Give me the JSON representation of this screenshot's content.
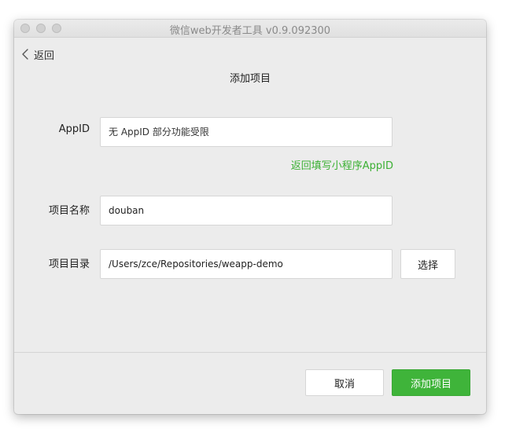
{
  "window": {
    "title": "微信web开发者工具 v0.9.092300"
  },
  "nav": {
    "back_label": "返回"
  },
  "page": {
    "title": "添加项目"
  },
  "form": {
    "appid": {
      "label": "AppID",
      "placeholder": "无 AppID 部分功能受限",
      "value": ""
    },
    "appid_link": "返回填写小程序AppID",
    "project_name": {
      "label": "项目名称",
      "value": "douban"
    },
    "project_dir": {
      "label": "项目目录",
      "value": "/Users/zce/Repositories/weapp-demo",
      "choose_label": "选择"
    }
  },
  "footer": {
    "cancel_label": "取消",
    "submit_label": "添加项目"
  },
  "colors": {
    "accent_green": "#3fb43a",
    "link_green": "#3cb034",
    "window_bg": "#ececec"
  },
  "icons": {
    "back": "chevron-left-icon"
  }
}
